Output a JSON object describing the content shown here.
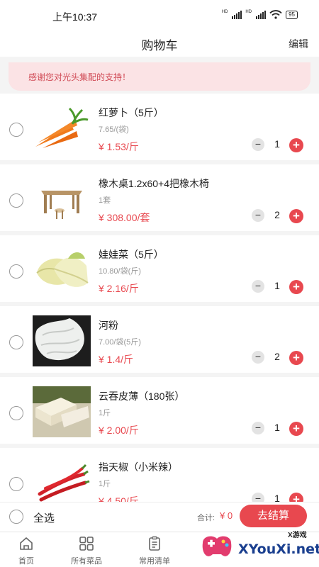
{
  "status_bar": {
    "time": "上午10:37",
    "battery": "95",
    "hd1": "HD",
    "hd2": "HD"
  },
  "header": {
    "title": "购物车",
    "edit_label": "编辑"
  },
  "banner": {
    "text": "感谢您对光头集配的支持！"
  },
  "cart": {
    "items": [
      {
        "name": "红萝卜（5斤）",
        "spec": "7.65/(袋)",
        "price": "¥ 1.53/斤",
        "qty": "1",
        "image_icon": "carrot-image"
      },
      {
        "name": "橡木桌1.2x60+4把橡木椅",
        "spec": "1套",
        "price": "¥ 308.00/套",
        "qty": "2",
        "image_icon": "table-chairs-image"
      },
      {
        "name": "娃娃菜（5斤）",
        "spec": "10.80/袋(斤)",
        "price": "¥ 2.16/斤",
        "qty": "1",
        "image_icon": "baby-cabbage-image"
      },
      {
        "name": "河粉",
        "spec": "7.00/袋(5斤)",
        "price": "¥ 1.4/斤",
        "qty": "2",
        "image_icon": "rice-noodle-image"
      },
      {
        "name": "云吞皮薄（180张）",
        "spec": "1斤",
        "price": "¥ 2.00/斤",
        "qty": "1",
        "image_icon": "wonton-wrapper-image"
      },
      {
        "name": "指天椒（小米辣）",
        "spec": "1斤",
        "price": "¥ 4.50/斤",
        "qty": "1",
        "image_icon": "chili-pepper-image"
      }
    ],
    "minus_symbol": "−",
    "plus_symbol": "+"
  },
  "checkout": {
    "select_all": "全选",
    "total_label": "合计:",
    "total_value": "¥ 0",
    "button_label": "去结算"
  },
  "tabs": [
    {
      "label": "首页",
      "icon": "home-icon"
    },
    {
      "label": "所有菜品",
      "icon": "grid-icon"
    },
    {
      "label": "常用清单",
      "icon": "list-icon"
    }
  ],
  "watermark": {
    "text": "XYouXi.net",
    "cn": "X游戏"
  },
  "colors": {
    "accent": "#e8484f",
    "banner_bg": "#fbe3e5"
  }
}
